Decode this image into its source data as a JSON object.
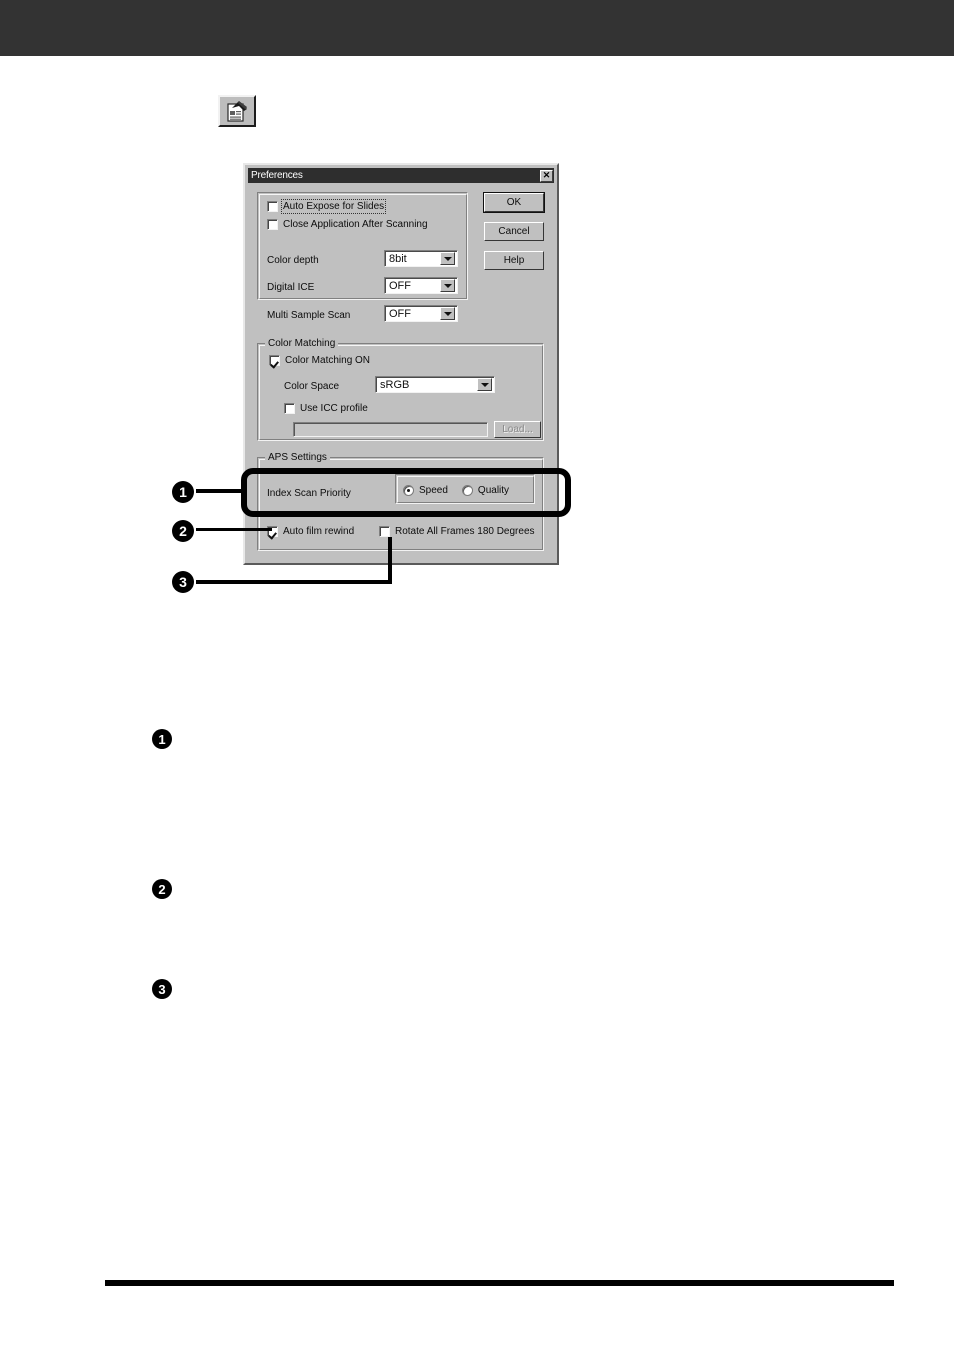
{
  "page": {
    "header_bar_color": "#333333",
    "footer_rule_color": "#000000"
  },
  "toolbar": {
    "preferences_button_name": "Preferences",
    "icon": "preferences-document-icon"
  },
  "dialog": {
    "title": "Preferences",
    "close_label": "✕",
    "general_group": {
      "auto_expose_label": "Auto Expose for Slides",
      "auto_expose_checked": false,
      "close_app_label": "Close Application After Scanning",
      "close_app_checked": false,
      "fields": [
        {
          "label": "Color depth",
          "value": "8bit"
        },
        {
          "label": "Digital ICE",
          "value": "OFF"
        },
        {
          "label": "Multi Sample Scan",
          "value": "OFF"
        }
      ]
    },
    "color_matching": {
      "group_title": "Color Matching",
      "on_label": "Color Matching ON",
      "on_checked": true,
      "color_space_label": "Color Space",
      "color_space_value": "sRGB",
      "use_icc_label": "Use ICC profile",
      "use_icc_checked": false,
      "icc_path_value": "",
      "load_label": "Load..."
    },
    "aps_settings": {
      "group_title": "APS Settings",
      "index_scan_priority_label": "Index Scan Priority",
      "options": [
        {
          "label": "Speed",
          "selected": true
        },
        {
          "label": "Quality",
          "selected": false
        }
      ],
      "auto_film_rewind_label": "Auto film rewind",
      "auto_film_rewind_checked": true,
      "rotate_all_frames_label": "Rotate All Frames 180 Degrees",
      "rotate_all_frames_checked": false
    },
    "buttons": {
      "ok": "OK",
      "cancel": "Cancel",
      "help": "Help"
    }
  },
  "callouts": {
    "diagram": [
      {
        "number": "1"
      },
      {
        "number": "2"
      },
      {
        "number": "3"
      }
    ],
    "body": [
      {
        "number": "1"
      },
      {
        "number": "2"
      },
      {
        "number": "3"
      }
    ]
  }
}
